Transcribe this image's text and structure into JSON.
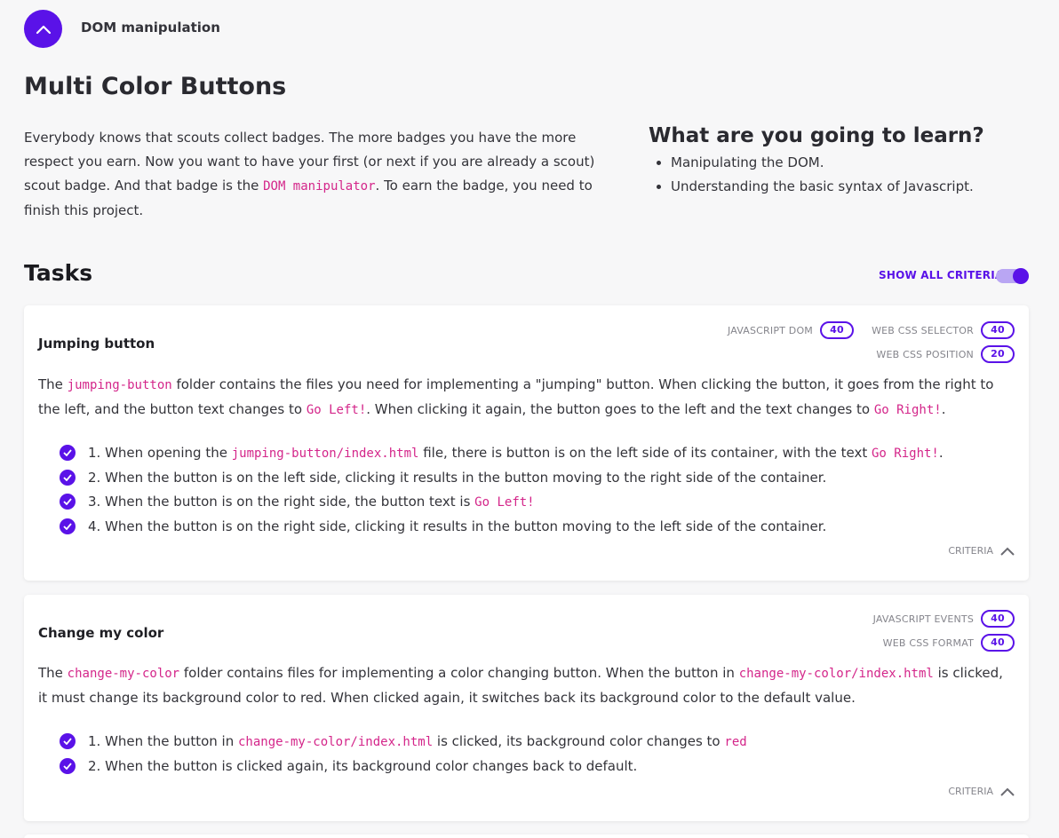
{
  "topbar": {
    "crumb": "DOM manipulation",
    "back_icon": "chevron-up-icon"
  },
  "page_title": "Multi Color Buttons",
  "intro": {
    "p1": "Everybody knows that scouts collect badges. The more badges you have the more respect you earn. Now you want to have your first (or next if you are already a scout) scout badge. And that badge is the ",
    "code": "DOM manipulator",
    "p2": ". To earn the badge, you need to finish this project."
  },
  "learn": {
    "title": "What are you going to learn?",
    "items": [
      "Manipulating the DOM.",
      "Understanding the basic syntax of Javascript."
    ]
  },
  "tasks": {
    "title": "Tasks",
    "show_all": "SHOW ALL CRITERIA",
    "criteria_label": "CRITERIA",
    "colors": {
      "accent": "#5a12e8",
      "code": "#d4268a"
    }
  },
  "task1": {
    "title": "Jumping button",
    "skills": [
      {
        "name": "JAVASCRIPT DOM",
        "points": "40"
      },
      {
        "name": "WEB CSS SELECTOR",
        "points": "40"
      },
      {
        "name": "WEB CSS POSITION",
        "points": "20"
      }
    ],
    "desc": {
      "a": "The ",
      "code1": "jumping-button",
      "b": " folder contains the files you need for implementing a \"jumping\" button. When clicking the button, it goes from the right to the left, and the button text changes to ",
      "code2": "Go Left!",
      "c": ". When clicking it again, the button goes to the left and the text changes to ",
      "code3": "Go Right!",
      "d": "."
    },
    "criteria": {
      "c1a": "1. When opening the ",
      "c1code": "jumping-button/index.html",
      "c1b": " file, there is button is on the left side of its container, with the text ",
      "c1code2": "Go Right!",
      "c1c": ".",
      "c2": "2. When the button is on the left side, clicking it results in the button moving to the right side of the container.",
      "c3a": "3. When the button is on the right side, the button text is ",
      "c3code": "Go Left!",
      "c4": "4. When the button is on the right side, clicking it results in the button moving to the left side of the container."
    }
  },
  "task2": {
    "title": "Change my color",
    "skills": [
      {
        "name": "JAVASCRIPT EVENTS",
        "points": "40"
      },
      {
        "name": "WEB CSS FORMAT",
        "points": "40"
      }
    ],
    "desc": {
      "a": "The ",
      "code1": "change-my-color",
      "b": " folder contains files for implementing a color changing button. When the button in ",
      "code2": "change-my-color/index.html",
      "c": " is clicked, it must change its background color to red. When clicked again, it switches back its background color to the default value."
    },
    "criteria": {
      "c1a": "1. When the button in ",
      "c1code": "change-my-color/index.html",
      "c1b": " is clicked, its background color changes to ",
      "c1code2": "red",
      "c2": "2. When the button is clicked again, its background color changes back to default."
    }
  }
}
